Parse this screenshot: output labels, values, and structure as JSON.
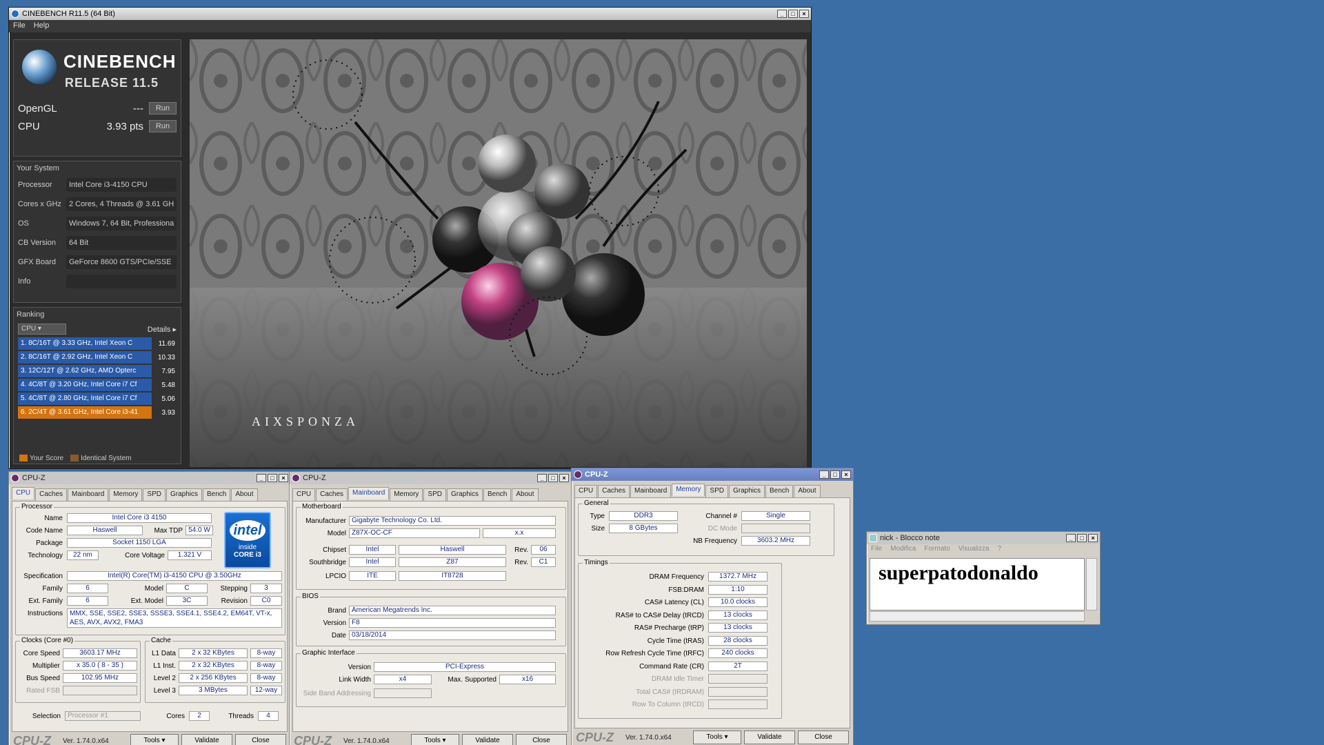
{
  "cinebench": {
    "title": "CINEBENCH R11.5 (64 Bit)",
    "menu": [
      "File",
      "Help"
    ],
    "logo_title": "CINEBENCH",
    "logo_sub": "RELEASE 11.5",
    "opengl_label": "OpenGL",
    "opengl_value": "---",
    "cpu_label": "CPU",
    "cpu_value": "3.93 pts",
    "run_label": "Run",
    "your_system": "Your System",
    "system": [
      {
        "k": "Processor",
        "v": "Intel Core i3-4150 CPU"
      },
      {
        "k": "Cores x GHz",
        "v": "2 Cores, 4 Threads @ 3.61 GH"
      },
      {
        "k": "OS",
        "v": "Windows 7, 64 Bit, Professiona"
      },
      {
        "k": "CB Version",
        "v": "64 Bit"
      },
      {
        "k": "GFX Board",
        "v": "GeForce 8600 GTS/PCIe/SSE"
      },
      {
        "k": "Info",
        "v": ""
      }
    ],
    "ranking_label": "Ranking",
    "ranking_dropdown": "CPU",
    "details_label": "Details",
    "ranking": [
      {
        "text": "1. 8C/16T @ 3.33 GHz, Intel Xeon C",
        "score": "11.69",
        "color": "#2a5aa8"
      },
      {
        "text": "2. 8C/16T @ 2.92 GHz, Intel Xeon C",
        "score": "10.33",
        "color": "#2a5aa8"
      },
      {
        "text": "3. 12C/12T @ 2.62 GHz, AMD Opterc",
        "score": "7.95",
        "color": "#2a5aa8"
      },
      {
        "text": "4. 4C/8T @ 3.20 GHz, Intel Core i7 Cf",
        "score": "5.48",
        "color": "#2a5aa8"
      },
      {
        "text": "5. 4C/8T @ 2.80 GHz, Intel Core i7 Cf",
        "score": "5.06",
        "color": "#2a5aa8"
      },
      {
        "text": "6. 2C/4T @ 3.61 GHz, Intel Core i3-41",
        "score": "3.93",
        "color": "#d4740f"
      }
    ],
    "legend_your": "Your Score",
    "legend_identical": "Identical System",
    "watermark": "AIXSPONZA"
  },
  "cpuz_common": {
    "title": "CPU-Z",
    "tabs": [
      "CPU",
      "Caches",
      "Mainboard",
      "Memory",
      "SPD",
      "Graphics",
      "Bench",
      "About"
    ],
    "logo": "CPU-Z",
    "version": "Ver. 1.74.0.x64",
    "tools": "Tools",
    "validate": "Validate",
    "close": "Close"
  },
  "cpuz1": {
    "processor_group": "Processor",
    "name_l": "Name",
    "name": "Intel Core i3 4150",
    "codename_l": "Code Name",
    "codename": "Haswell",
    "maxtdp_l": "Max TDP",
    "maxtdp": "54.0 W",
    "package_l": "Package",
    "package": "Socket 1150 LGA",
    "tech_l": "Technology",
    "tech": "22 nm",
    "cvolt_l": "Core Voltage",
    "cvolt": "1.321 V",
    "spec_l": "Specification",
    "spec": "Intel(R) Core(TM) i3-4150 CPU @ 3.50GHz",
    "family_l": "Family",
    "family": "6",
    "model_l": "Model",
    "model": "C",
    "stepping_l": "Stepping",
    "stepping": "3",
    "extfam_l": "Ext. Family",
    "extfam": "6",
    "extmodel_l": "Ext. Model",
    "extmodel": "3C",
    "revision_l": "Revision",
    "revision": "C0",
    "instr_l": "Instructions",
    "instr": "MMX, SSE, SSE2, SSE3, SSSE3, SSE4.1, SSE4.2, EM64T, VT-x, AES, AVX, AVX2, FMA3",
    "intel_logo": "intel",
    "intel_inside": "inside",
    "intel_core": "CORE i3",
    "clocks_group": "Clocks (Core #0)",
    "corespeed_l": "Core Speed",
    "corespeed": "3603.17 MHz",
    "mult_l": "Multiplier",
    "mult": "x 35.0 ( 8 - 35 )",
    "bus_l": "Bus Speed",
    "bus": "102.95 MHz",
    "fsb_l": "Rated FSB",
    "fsb": "",
    "cache_group": "Cache",
    "l1d_l": "L1 Data",
    "l1d": "2 x 32 KBytes",
    "l1d_w": "8-way",
    "l1i_l": "L1 Inst.",
    "l1i": "2 x 32 KBytes",
    "l1i_w": "8-way",
    "l2_l": "Level 2",
    "l2": "2 x 256 KBytes",
    "l2_w": "8-way",
    "l3_l": "Level 3",
    "l3": "3 MBytes",
    "l3_w": "12-way",
    "selection_l": "Selection",
    "selection": "Processor #1",
    "cores_l": "Cores",
    "cores": "2",
    "threads_l": "Threads",
    "threads": "4"
  },
  "cpuz2": {
    "mb_group": "Motherboard",
    "manufacturer_l": "Manufacturer",
    "manufacturer": "Gigabyte Technology Co. Ltd.",
    "model_l": "Model",
    "model": "Z87X-OC-CF",
    "model_rev": "x.x",
    "chipset_l": "Chipset",
    "chipset": "Intel",
    "chipset_name": "Haswell",
    "chipset_rev_l": "Rev.",
    "chipset_rev": "06",
    "south_l": "Southbridge",
    "south": "Intel",
    "south_name": "Z87",
    "south_rev_l": "Rev.",
    "south_rev": "C1",
    "lpcio_l": "LPCIO",
    "lpcio": "ITE",
    "lpcio_name": "IT8728",
    "bios_group": "BIOS",
    "brand_l": "Brand",
    "brand": "American Megatrends Inc.",
    "version_l": "Version",
    "version": "F8",
    "date_l": "Date",
    "date": "03/18/2014",
    "gi_group": "Graphic Interface",
    "giver_l": "Version",
    "giver": "PCI-Express",
    "lw_l": "Link Width",
    "lw": "x4",
    "ms_l": "Max. Supported",
    "ms": "x16",
    "sba_l": "Side Band Addressing",
    "sba": ""
  },
  "cpuz3": {
    "general_group": "General",
    "type_l": "Type",
    "type": "DDR3",
    "channel_l": "Channel #",
    "channel": "Single",
    "size_l": "Size",
    "size": "8 GBytes",
    "dcmode_l": "DC Mode",
    "dcmode": "",
    "nbfreq_l": "NB Frequency",
    "nbfreq": "3603.2 MHz",
    "timings_group": "Timings",
    "timings": [
      {
        "k": "DRAM Frequency",
        "v": "1372.7 MHz"
      },
      {
        "k": "FSB:DRAM",
        "v": "1:10"
      },
      {
        "k": "CAS# Latency (CL)",
        "v": "10.0 clocks"
      },
      {
        "k": "RAS# to CAS# Delay (tRCD)",
        "v": "13 clocks"
      },
      {
        "k": "RAS# Precharge (tRP)",
        "v": "13 clocks"
      },
      {
        "k": "Cycle Time (tRAS)",
        "v": "28 clocks"
      },
      {
        "k": "Row Refresh Cycle Time (tRFC)",
        "v": "240 clocks"
      },
      {
        "k": "Command Rate (CR)",
        "v": "2T"
      },
      {
        "k": "DRAM Idle Timer",
        "v": ""
      },
      {
        "k": "Total CAS# (tRDRAM)",
        "v": ""
      },
      {
        "k": "Row To Column (tRCD)",
        "v": ""
      }
    ]
  },
  "notepad": {
    "title": "nick - Blocco note",
    "menu": [
      "File",
      "Modifica",
      "Formato",
      "Visualizza",
      "?"
    ],
    "text": "superpatodonaldo"
  }
}
